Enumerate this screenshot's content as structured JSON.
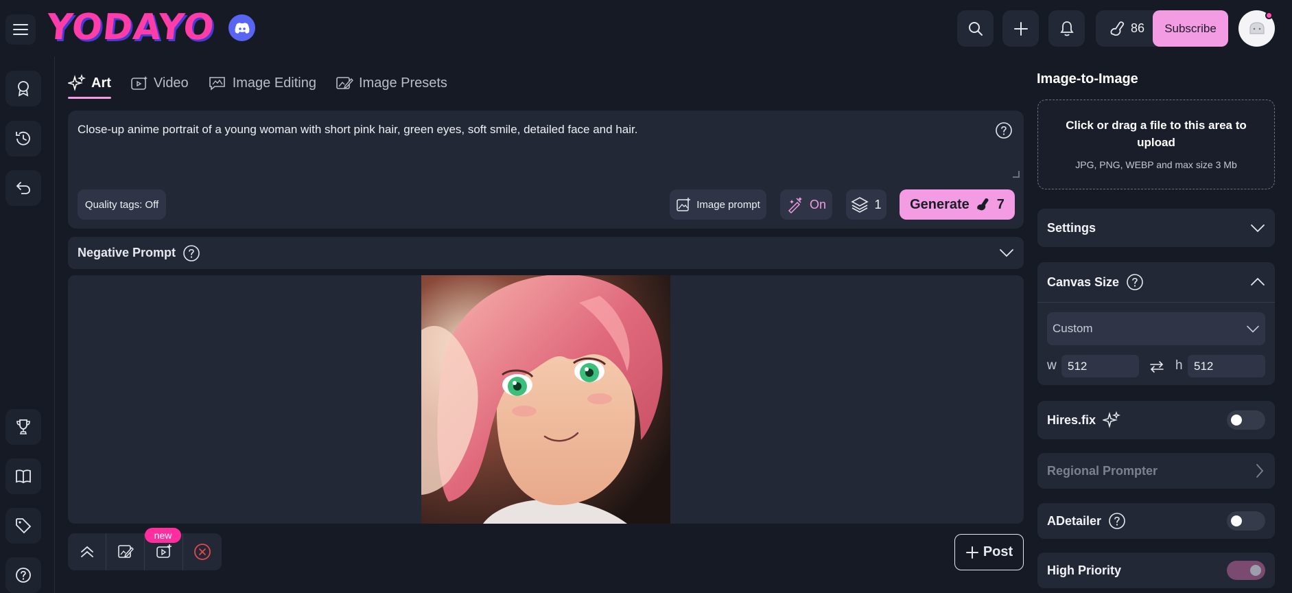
{
  "header": {
    "logo_text": "YODAYO",
    "credits": "86",
    "subscribe_label": "Subscribe",
    "icons": [
      "menu-icon",
      "discord-icon",
      "search-icon",
      "plus-icon",
      "bell-icon",
      "coin-icon",
      "avatar-icon"
    ]
  },
  "sidebar": {
    "items": [
      {
        "icon": "badge-icon"
      },
      {
        "icon": "history-icon"
      },
      {
        "icon": "undo-icon"
      },
      {
        "icon": "trophy-icon"
      },
      {
        "icon": "book-icon"
      },
      {
        "icon": "tag-icon"
      },
      {
        "icon": "help-icon"
      }
    ]
  },
  "tabs": [
    {
      "label": "Art",
      "icon": "sparkles-icon",
      "active": true
    },
    {
      "label": "Video",
      "icon": "video-icon",
      "active": false
    },
    {
      "label": "Image Editing",
      "icon": "image-edit-icon",
      "active": false
    },
    {
      "label": "Image Presets",
      "icon": "preset-icon",
      "active": false
    }
  ],
  "prompt": {
    "text": "Close-up anime portrait of a young woman with short pink hair, green eyes, soft smile, detailed face and hair.",
    "quality_tags": "Quality tags: Off",
    "image_prompt_label": "Image prompt",
    "enhance_label": "On",
    "batch_count": "1",
    "generate_label": "Generate",
    "generate_cost": "7"
  },
  "negative_prompt": {
    "label": "Negative Prompt"
  },
  "canvas_actions": {
    "new_badge": "new",
    "post_label": "Post"
  },
  "right_panel": {
    "title": "Image-to-Image",
    "upload_main": "Click or drag a file to this area to upload",
    "upload_sub": "JPG, PNG, WEBP and max size 3 Mb",
    "settings_label": "Settings",
    "canvas_size": {
      "label": "Canvas Size",
      "preset": "Custom",
      "w_label": "w",
      "w_value": "512",
      "h_label": "h",
      "h_value": "512"
    },
    "hires_fix": {
      "label": "Hires.fix",
      "enabled": false
    },
    "regional_prompter": {
      "label": "Regional Prompter"
    },
    "adetailer": {
      "label": "ADetailer",
      "enabled": false
    },
    "high_priority": {
      "label": "High Priority",
      "enabled": true
    }
  },
  "colors": {
    "accent": "#f39be3",
    "background": "#161a24",
    "panel": "#232836",
    "badge": "#ff2d9d"
  }
}
